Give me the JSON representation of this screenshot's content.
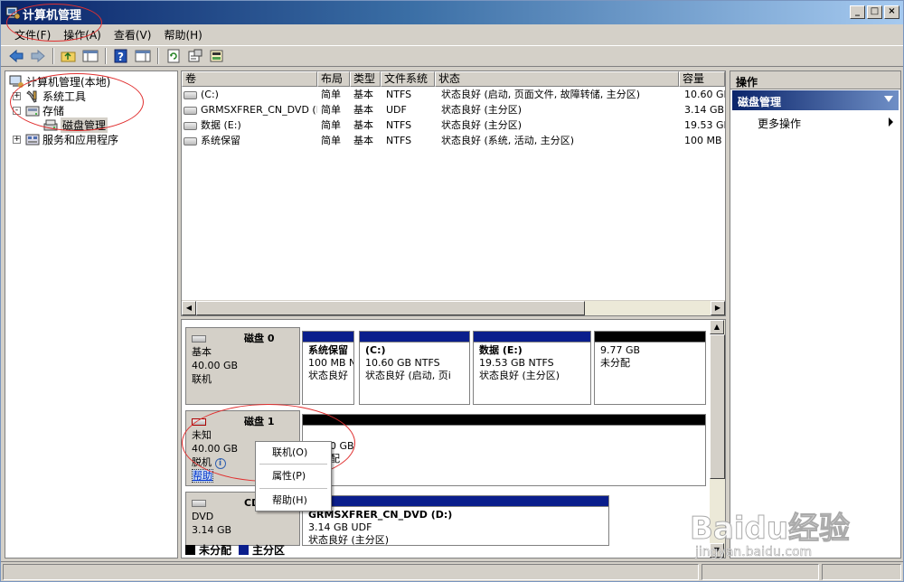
{
  "window": {
    "title": "计算机管理",
    "colors": {
      "titlebar_start": "#0a246a",
      "titlebar_end": "#a6caf0",
      "primary_partition": "#0a1e8c",
      "unallocated": "#000000",
      "annotation": "#e03030"
    }
  },
  "menu": [
    "文件(F)",
    "操作(A)",
    "查看(V)",
    "帮助(H)"
  ],
  "toolbar": {
    "icons": [
      "back-arrow-icon",
      "forward-arrow-icon",
      "up-folder-icon",
      "show-hide-tree-icon",
      "help-icon",
      "show-hide-action-icon",
      "refresh-icon",
      "properties-icon",
      "export-icon"
    ]
  },
  "tree": {
    "root": "计算机管理(本地)",
    "items": [
      {
        "label": "系统工具",
        "expander": "+"
      },
      {
        "label": "存储",
        "expander": "-"
      },
      {
        "label": "磁盘管理"
      },
      {
        "label": "服务和应用程序",
        "expander": "+"
      }
    ]
  },
  "volumes": {
    "columns": [
      "卷",
      "布局",
      "类型",
      "文件系统",
      "状态",
      "容量"
    ],
    "rows": [
      {
        "name": "(C:)",
        "layout": "简单",
        "type": "基本",
        "fs": "NTFS",
        "status": "状态良好 (启动, 页面文件, 故障转储, 主分区)",
        "capacity": "10.60 GB"
      },
      {
        "name": "GRMSXFRER_CN_DVD (D:)",
        "layout": "简单",
        "type": "基本",
        "fs": "UDF",
        "status": "状态良好 (主分区)",
        "capacity": "3.14 GB"
      },
      {
        "name": "数据 (E:)",
        "layout": "简单",
        "type": "基本",
        "fs": "NTFS",
        "status": "状态良好 (主分区)",
        "capacity": "19.53 GB"
      },
      {
        "name": "系统保留",
        "layout": "简单",
        "type": "基本",
        "fs": "NTFS",
        "status": "状态良好 (系统, 活动, 主分区)",
        "capacity": "100 MB"
      }
    ]
  },
  "disks": [
    {
      "name": "磁盘 0",
      "kind": "基本",
      "size": "40.00 GB",
      "state": "联机",
      "partitions": [
        {
          "name": "系统保留",
          "size_fs": "100 MB N",
          "status": "状态良好"
        },
        {
          "name": "(C:)",
          "size_fs": "10.60 GB NTFS",
          "status": "状态良好 (启动, 页i"
        },
        {
          "name": "数据  (E:)",
          "size_fs": "19.53 GB NTFS",
          "status": "状态良好 (主分区)"
        },
        {
          "name": "",
          "size_fs": "9.77 GB",
          "status": "未分配"
        }
      ]
    },
    {
      "name": "磁盘 1",
      "kind": "未知",
      "size": "40.00 GB",
      "state": "脱机",
      "help": "帮助",
      "partitions": [
        {
          "size_fs": "0 GB",
          "status": "配"
        }
      ]
    },
    {
      "name": "CD-R(",
      "kind": "DVD",
      "size": "3.14 GB",
      "partitions": [
        {
          "name": "GRMSXFRER_CN_DVD   (D:)",
          "size_fs": "3.14 GB UDF",
          "status": "状态良好 (主分区)"
        }
      ]
    }
  ],
  "legend": [
    {
      "label": "未分配",
      "color": "#000000"
    },
    {
      "label": "主分区",
      "color": "#0a1e8c"
    }
  ],
  "actions": {
    "title": "操作",
    "section": "磁盘管理",
    "more": "更多操作"
  },
  "context_menu": [
    "联机(O)",
    "属性(P)",
    "帮助(H)"
  ],
  "watermark": {
    "brand": "Baidu经验",
    "url": "jingyan.baidu.com"
  }
}
